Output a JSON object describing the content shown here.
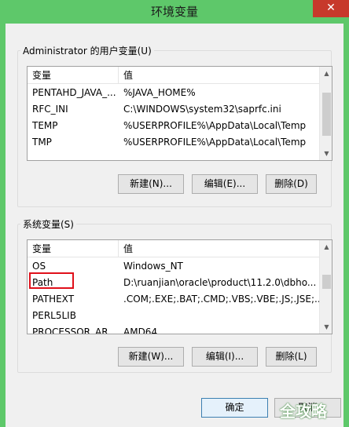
{
  "window": {
    "title": "环境变量",
    "close_glyph": "✕"
  },
  "user_group": {
    "label": "Administrator 的用户变量(U)",
    "columns": [
      "变量",
      "值"
    ],
    "rows": [
      {
        "name": "PENTAHD_JAVA_...",
        "value": "%JAVA_HOME%"
      },
      {
        "name": "RFC_INI",
        "value": "C:\\WINDOWS\\system32\\saprfc.ini"
      },
      {
        "name": "TEMP",
        "value": "%USERPROFILE%\\AppData\\Local\\Temp"
      },
      {
        "name": "TMP",
        "value": "%USERPROFILE%\\AppData\\Local\\Temp"
      }
    ],
    "buttons": {
      "new": "新建(N)...",
      "edit": "编辑(E)...",
      "delete": "删除(D)"
    }
  },
  "system_group": {
    "label": "系统变量(S)",
    "columns": [
      "变量",
      "值"
    ],
    "rows": [
      {
        "name": "OS",
        "value": "Windows_NT"
      },
      {
        "name": "Path",
        "value": "D:\\ruanjian\\oracle\\product\\11.2.0\\dbho..."
      },
      {
        "name": "PATHEXT",
        "value": ".COM;.EXE;.BAT;.CMD;.VBS;.VBE;.JS;.JSE;..."
      },
      {
        "name": "PERL5LIB",
        "value": ""
      },
      {
        "name": "PROCESSOR_AR...",
        "value": "AMD64"
      }
    ],
    "buttons": {
      "new": "新建(W)...",
      "edit": "编辑(I)...",
      "delete": "删除(L)"
    }
  },
  "footer": {
    "ok": "确定",
    "cancel": "取消"
  },
  "watermark": "全攻略",
  "colors": {
    "window_frame": "#5ec86a",
    "highlight": "#e0101a"
  }
}
